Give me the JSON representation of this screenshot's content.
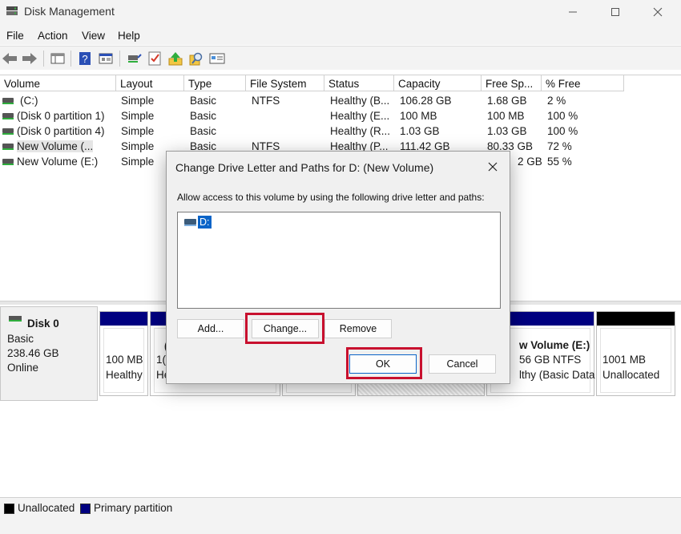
{
  "window": {
    "title": "Disk Management",
    "minimize_label": "",
    "maximize_label": "",
    "close_label": ""
  },
  "menu": [
    "File",
    "Action",
    "View",
    "Help"
  ],
  "toolbar_icons": [
    "back-icon",
    "forward-icon",
    "disk-list-icon",
    "help-icon",
    "properties-icon",
    "connect-icon",
    "checklist-icon",
    "up-icon",
    "search-icon",
    "display-icon"
  ],
  "columns": [
    "Volume",
    "Layout",
    "Type",
    "File System",
    "Status",
    "Capacity",
    "Free Sp...",
    "% Free"
  ],
  "volumes": [
    {
      "volume": "(C:)",
      "layout": "Simple",
      "type": "Basic",
      "fs": "NTFS",
      "status": "Healthy (B...",
      "capacity": "106.28 GB",
      "free": "1.68 GB",
      "pct": "2 %"
    },
    {
      "volume": "(Disk 0 partition 1)",
      "layout": "Simple",
      "type": "Basic",
      "fs": "",
      "status": "Healthy (E...",
      "capacity": "100 MB",
      "free": "100 MB",
      "pct": "100 %"
    },
    {
      "volume": "(Disk 0 partition 4)",
      "layout": "Simple",
      "type": "Basic",
      "fs": "",
      "status": "Healthy (R...",
      "capacity": "1.03 GB",
      "free": "1.03 GB",
      "pct": "100 %"
    },
    {
      "volume": "New Volume (...",
      "layout": "Simple",
      "type": "Basic",
      "fs": "NTFS",
      "status": "Healthy (P...",
      "capacity": "111.42 GB",
      "free": "80.33 GB",
      "pct": "72 %"
    },
    {
      "volume": "New Volume (E:)",
      "layout": "Simple",
      "type": "",
      "fs": "",
      "status": "",
      "capacity": "",
      "free": "2 GB",
      "pct": "55 %"
    }
  ],
  "disk": {
    "name": "Disk 0",
    "type": "Basic",
    "size": "238.46 GB",
    "state": "Online"
  },
  "partitions": {
    "p1": {
      "line1": "100 MB",
      "line2": "Healthy"
    },
    "p2": {
      "line1": "1(",
      "line2": "He"
    },
    "p3": {
      "line1": "(",
      "line2": ""
    },
    "e": {
      "line1": "w Volume  (E:)",
      "line2": "56 GB NTFS",
      "line3": "lthy (Basic Data"
    },
    "unalloc": {
      "line1": "1001 MB",
      "line2": "Unallocated"
    }
  },
  "legend": [
    {
      "label": "Unallocated",
      "color": "#000000"
    },
    {
      "label": "Primary partition",
      "color": "#000080"
    }
  ],
  "colors": {
    "primary": "#000080",
    "unallocated": "#000000",
    "highlight": "#c8102e",
    "selection": "#0a64c8"
  },
  "dialog": {
    "title": "Change Drive Letter and Paths for D: (New Volume)",
    "description": "Allow access to this volume by using the following drive letter and paths:",
    "paths": [
      "D:"
    ],
    "add_label": "Add...",
    "change_label": "Change...",
    "remove_label": "Remove",
    "ok_label": "OK",
    "cancel_label": "Cancel"
  }
}
